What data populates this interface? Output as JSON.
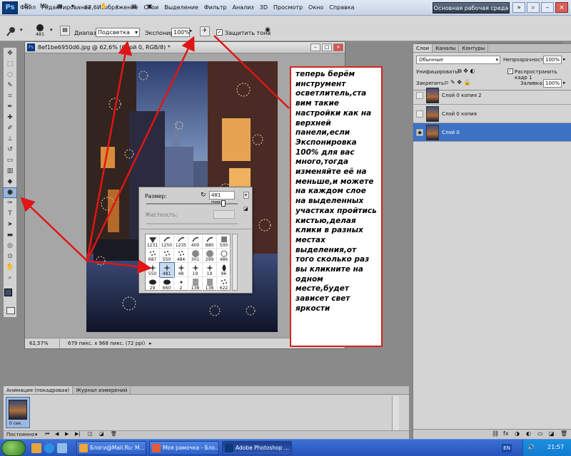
{
  "menu": {
    "items": [
      "Файл",
      "Редактирование",
      "Изображение",
      "Слои",
      "Выделение",
      "Фильтр",
      "Анализ",
      "3D",
      "Просмотр",
      "Окно",
      "Справка"
    ],
    "zoom": "62,6",
    "workspace": "Основная рабочая среда"
  },
  "options": {
    "brush_size": "481",
    "range_label": "Диапазон:",
    "range_value": "Подсветка",
    "exposure_label": "Экспонир.:",
    "exposure_value": "100%",
    "protect_label": "Защитить тона"
  },
  "document": {
    "title": "8ef1be6950d6.jpg @ 62,6% (Слой 0, RGB/8) *",
    "zoom": "62,57%",
    "info": "679 пикс. x 968 пикс. (72 ppi)"
  },
  "brush_panel": {
    "size_label": "Размер:",
    "size_value": "481 пикс",
    "hardness_label": "Жесткость:",
    "brushes": [
      {
        "size": "1231",
        "shape": "fan"
      },
      {
        "size": "1250",
        "shape": "stroke"
      },
      {
        "size": "1235",
        "shape": "stroke"
      },
      {
        "size": "400",
        "shape": "stroke"
      },
      {
        "size": "880",
        "shape": "stroke"
      },
      {
        "size": "500",
        "shape": "block"
      },
      {
        "size": "687",
        "shape": "scatter"
      },
      {
        "size": "550",
        "shape": "scatter"
      },
      {
        "size": "484",
        "shape": "scatter"
      },
      {
        "size": "301",
        "shape": "round"
      },
      {
        "size": "299",
        "shape": "round"
      },
      {
        "size": "486",
        "shape": "ring"
      },
      {
        "size": "550",
        "shape": "star"
      },
      {
        "size": "481",
        "shape": "star"
      },
      {
        "size": "48",
        "shape": "star"
      },
      {
        "size": "19",
        "shape": "star"
      },
      {
        "size": "19",
        "shape": "star"
      },
      {
        "size": "96",
        "shape": "leaf"
      },
      {
        "size": "29",
        "shape": "blob"
      },
      {
        "size": "660",
        "shape": "blob"
      },
      {
        "size": "2",
        "shape": "dot"
      },
      {
        "size": "138",
        "shape": "grad"
      },
      {
        "size": "138",
        "shape": "grad"
      },
      {
        "size": "622",
        "shape": "scatter"
      }
    ]
  },
  "note": "теперь берём инструмент осветлитель,ста вим такие настройки как на верхней панели,если Экспонировка 100% для вас много,тогда изменяйте её на меньше,и можете на каждом слое на выделенных участках пройтись кистью,делая клики в разных местах выделения,от того сколько раз вы кликните на одном месте,будет зависет свет яркости",
  "layers_panel": {
    "tabs": [
      "Слои",
      "Каналы",
      "Контуры"
    ],
    "blend_mode": "Обычные",
    "opacity_label": "Непрозрачность:",
    "opacity_value": "100%",
    "unify_label": "Унифицировать:",
    "propagate_label": "Распространить кадр 1",
    "lock_label": "Закрепить:",
    "fill_label": "Заливка:",
    "fill_value": "100%",
    "layers": [
      {
        "name": "Слой 0 копия 2",
        "selected": false,
        "visible": false
      },
      {
        "name": "Слой 0 копия",
        "selected": false,
        "visible": false
      },
      {
        "name": "Слой 0",
        "selected": true,
        "visible": true
      }
    ]
  },
  "animation_panel": {
    "tabs": [
      "Анимация (покадровая)",
      "Журнал измерений"
    ],
    "frame_time": "0 сек.",
    "loop": "Постоянно"
  },
  "taskbar": {
    "buttons": [
      {
        "label": "Блоги@Mail.Ru: M...",
        "active": false
      },
      {
        "label": "Моя рамочка - Бло...",
        "active": false
      },
      {
        "label": "Adobe Photoshop ...",
        "active": true
      }
    ],
    "lang": "EN",
    "time": "21:57"
  }
}
